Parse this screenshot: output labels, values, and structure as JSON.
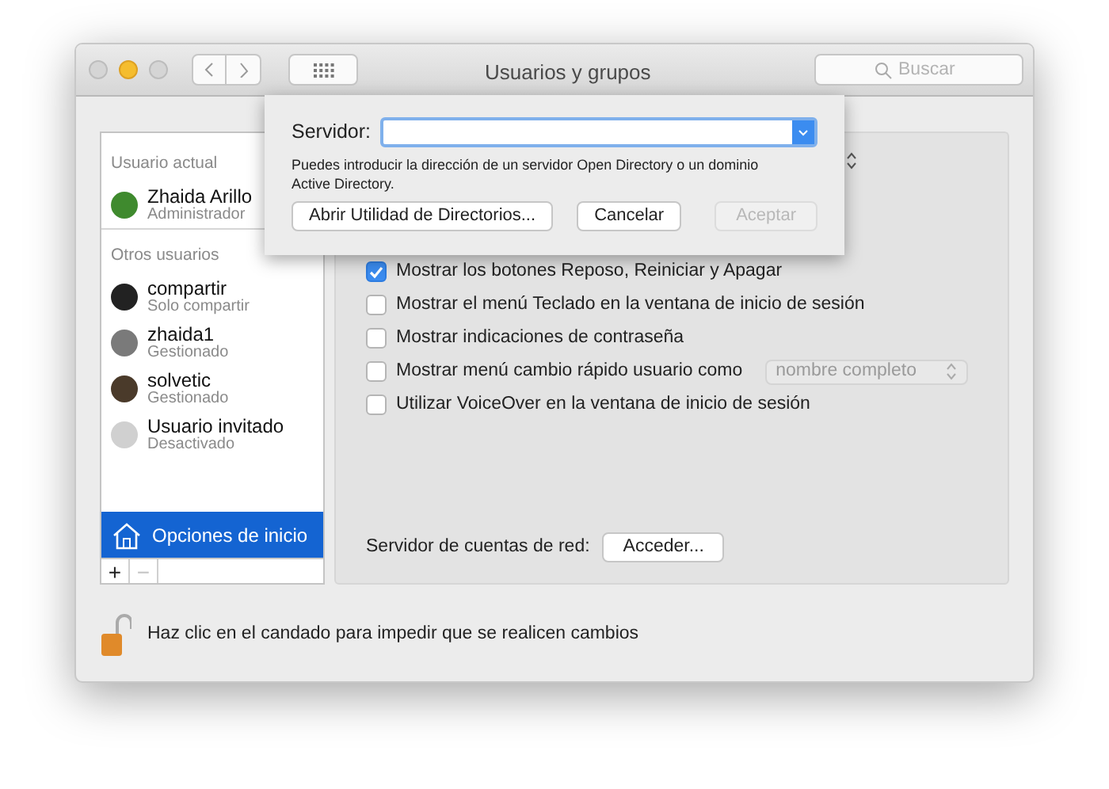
{
  "window": {
    "title": "Usuarios y grupos",
    "search": {
      "placeholder": "Buscar"
    }
  },
  "sidebar": {
    "sections": [
      {
        "header": "Usuario actual",
        "users": [
          {
            "name": "Zhaida Arillo",
            "role": "Administrador",
            "color": "#3f8a2e"
          }
        ]
      },
      {
        "header": "Otros usuarios",
        "users": [
          {
            "name": "compartir",
            "role": "Solo compartir",
            "color": "#222222"
          },
          {
            "name": "zhaida1",
            "role": "Gestionado",
            "color": "#7a7a7a"
          },
          {
            "name": "solvetic",
            "role": "Gestionado",
            "color": "#4a3a2a"
          },
          {
            "name": "Usuario invitado",
            "role": "Desactivado",
            "color": "#d0d0d0"
          }
        ]
      }
    ],
    "login_options": {
      "label": "Opciones de inicio",
      "selected": true
    },
    "add_button": "+",
    "remove_button": {
      "label": "−",
      "disabled": true
    }
  },
  "options": [
    {
      "label": "Mostrar los botones Reposo, Reiniciar y Apagar",
      "checked": true
    },
    {
      "label": "Mostrar el menú Teclado en la ventana de inicio de sesión",
      "checked": false
    },
    {
      "label": "Mostrar indicaciones de contraseña",
      "checked": false
    },
    {
      "label": "Mostrar menú cambio rápido usuario como",
      "checked": false,
      "popup": "nombre completo"
    },
    {
      "label": "Utilizar VoiceOver en la ventana de inicio de sesión",
      "checked": false
    }
  ],
  "network_server": {
    "label": "Servidor de cuentas de red:",
    "button": "Acceder..."
  },
  "lock": {
    "text": "Haz clic en el candado para impedir que se realicen cambios",
    "locked": false
  },
  "sheet": {
    "field_label": "Servidor:",
    "hint": "Puedes introducir la dirección de un servidor Open Directory o un dominio Active Directory.",
    "buttons": [
      {
        "label": "Abrir Utilidad de Directorios...",
        "disabled": false
      },
      {
        "label": "Cancelar",
        "disabled": false
      },
      {
        "label": "Aceptar",
        "disabled": true
      }
    ]
  }
}
